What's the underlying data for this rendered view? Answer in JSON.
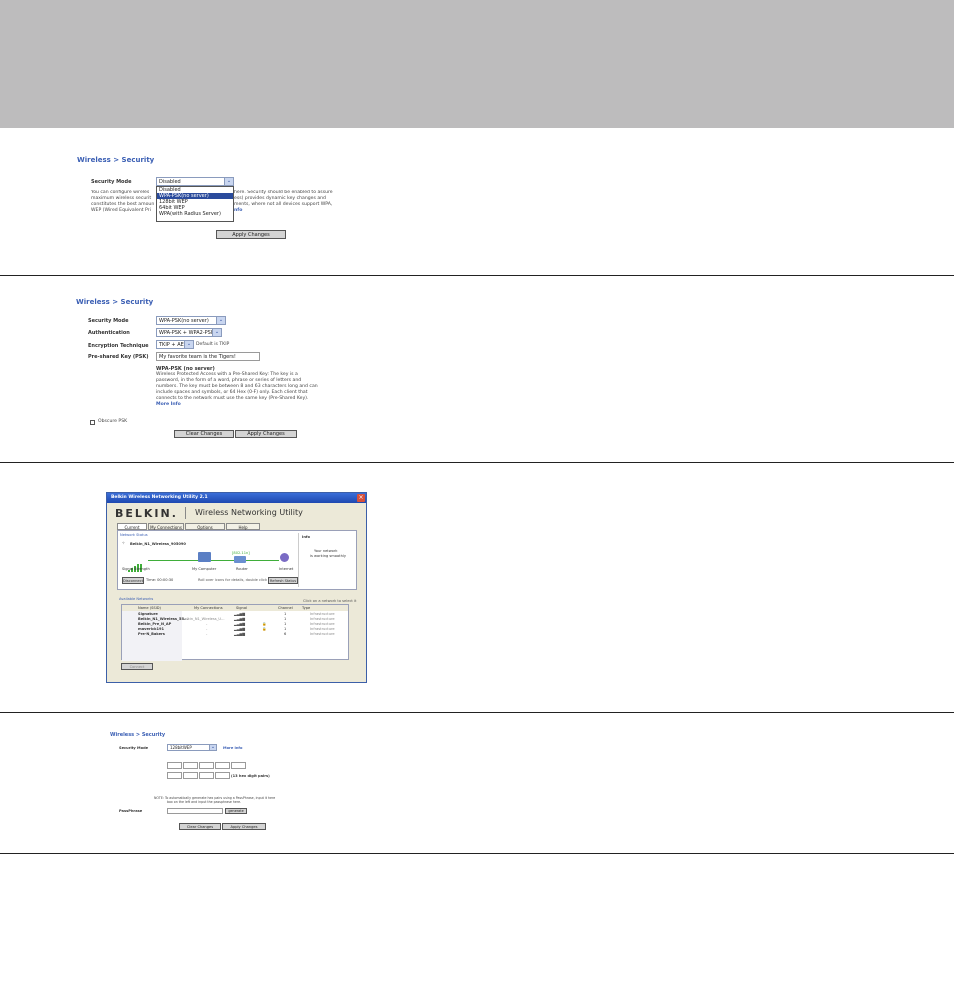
{
  "colors": {
    "top_band": "#bdbcbd",
    "link_blue": "#3b5fb4",
    "highlight": "#2a4b9c"
  },
  "panel1": {
    "breadcrumb": "Wireless > Security",
    "security_mode_label": "Security Mode",
    "security_mode_value": "Disabled",
    "dropdown_options": [
      "Disabled",
      "WPA-PSK(no server)",
      "128bit WEP",
      "64bit WEP",
      "WPA(with Radius Server)"
    ],
    "description_lines": [
      "You can configure wireles",
      "maximum wireless securit",
      "constitutes the best amoun",
      "WEP (Wired Equivalent Pri"
    ],
    "description_right_lines": [
      "here. Security should be enabled to assure",
      "ess) provides dynamic key changes and",
      "ments, where not all devices support WPA,",
      "nfo"
    ],
    "apply_button": "Apply Changes"
  },
  "panel2": {
    "breadcrumb": "Wireless > Security",
    "security_mode_label": "Security Mode",
    "security_mode_value": "WPA-PSK(no server)",
    "authentication_label": "Authentication",
    "authentication_value": "WPA-PSK + WPA2-PSK",
    "encryption_label": "Encryption Technique",
    "encryption_value": "TKIP + AES",
    "encryption_note": "Default is TKIP",
    "psk_label": "Pre-shared Key (PSK)",
    "psk_value": "My favorite team is the Tigers!",
    "help_title": "WPA-PSK (no server)",
    "help_lines": [
      "Wireless Protected Access with a Pre-Shared Key: The key is a",
      "password, in the form of a word, phrase or series of letters and",
      "numbers. The key must be between 8 and 63 characters long and can",
      "include spaces and symbols, or 64 Hex (0-F) only. Each client that",
      "connects to the network must use the same key (Pre-Shared Key)."
    ],
    "more_info": "More Info",
    "obscure_label": "Obscure PSK",
    "clear_button": "Clear Changes",
    "apply_button": "Apply Changes"
  },
  "panel3": {
    "window_title": "Belkin Wireless Networking Utility 2.1",
    "brand": "BELKIN.",
    "app_title": "Wireless Networking Utility",
    "tabs": [
      "Current Status",
      "My Connections",
      "Options",
      "Help"
    ],
    "network_status_label": "Network Status",
    "connected_ssid": "Belkin_N1_Wireless_905090",
    "info_label": "Info",
    "info_text_1": "Your network",
    "info_text_2": "is working smoothly",
    "node_labels": [
      "Signal Strength",
      "My Computer",
      "Router",
      "Internet"
    ],
    "link_label": "[802.11n]",
    "disconnect_button": "Disconnect",
    "time_label": "Time: 00:00:30",
    "hint": "Roll over icons for details, double click to repair",
    "refresh_button": "Refresh Status",
    "available_label": "Available Networks",
    "available_hint": "Click on a network to select it",
    "columns": [
      "Name (SSID)",
      "My Connections",
      "Signal",
      "Channel",
      "Type"
    ],
    "networks": [
      {
        "name": "Signature",
        "conn": "",
        "ch": "1",
        "type": "Infrastructure"
      },
      {
        "name": "Belkin_N1_Wireless_55...",
        "conn": "Belkin_N1_Wireless_U...",
        "ch": "1",
        "type": "Infrastructure"
      },
      {
        "name": "Belkin_Pre_N_AP",
        "conn": "-",
        "ch": "1",
        "type": "Infrastructure"
      },
      {
        "name": "maverick191",
        "conn": "-",
        "ch": "1",
        "type": "Infrastructure"
      },
      {
        "name": "Pre-N_Bakers",
        "conn": "-",
        "ch": "6",
        "type": "Infrastructure"
      }
    ],
    "connect_button": "Connect"
  },
  "panel4": {
    "breadcrumb": "Wireless > Security",
    "security_mode_label": "Security Mode",
    "security_mode_value": "128bitWEP",
    "more_info": "More Info",
    "hex_note": "(13 hex digit pairs)",
    "note_1": "NOTE:   To automatically generate hex pairs using a PassPhrase, input it here",
    "note_2": "box on the left and input the passphrase here.",
    "passphrase_label": "PassPhrase",
    "generate_button": "generate",
    "clear_button": "Clear Changes",
    "apply_button": "Apply Changes"
  }
}
